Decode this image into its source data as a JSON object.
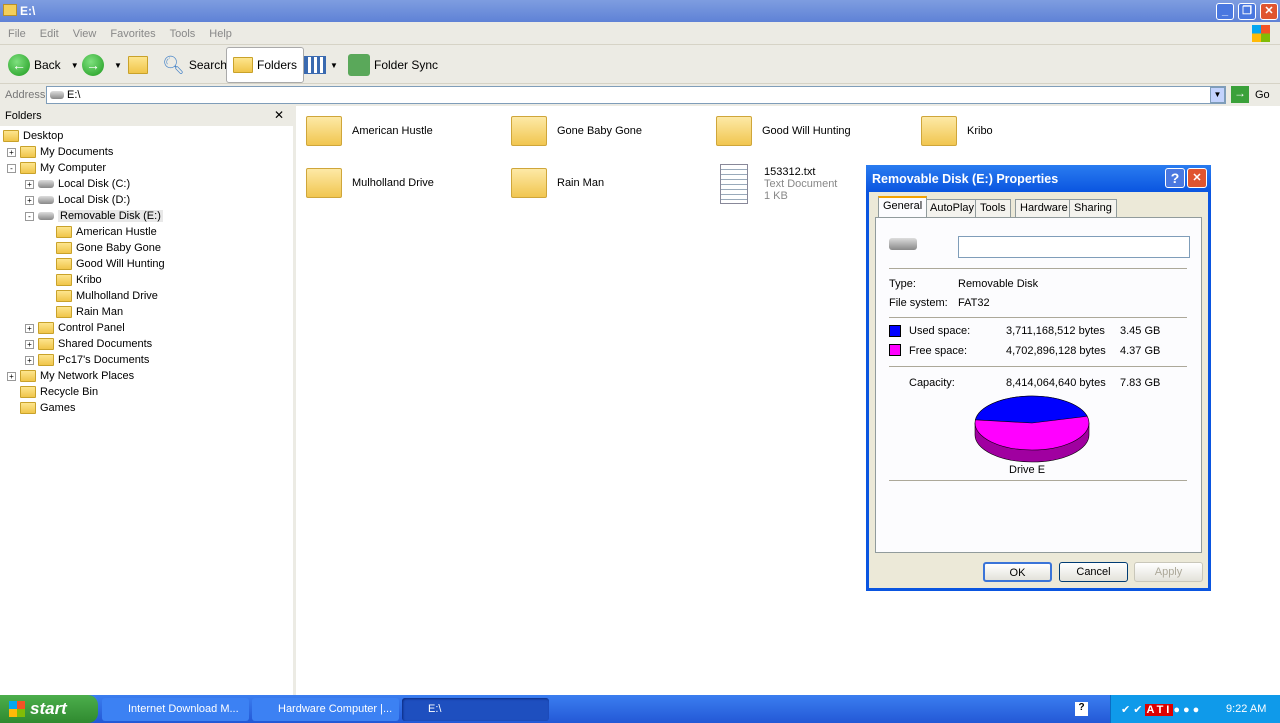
{
  "window": {
    "title": "E:\\"
  },
  "menu": [
    "File",
    "Edit",
    "View",
    "Favorites",
    "Tools",
    "Help"
  ],
  "toolbar": {
    "back": "Back",
    "search": "Search",
    "folders": "Folders",
    "folder_sync": "Folder Sync"
  },
  "address": {
    "label": "Address",
    "value": "E:\\",
    "go": "Go"
  },
  "folders_pane": {
    "title": "Folders",
    "tree": [
      {
        "label": "Desktop",
        "level": 0,
        "exp": ""
      },
      {
        "label": "My Documents",
        "level": 1,
        "exp": "+"
      },
      {
        "label": "My Computer",
        "level": 1,
        "exp": "-"
      },
      {
        "label": "Local Disk (C:)",
        "level": 2,
        "exp": "+"
      },
      {
        "label": "Local Disk (D:)",
        "level": 2,
        "exp": "+"
      },
      {
        "label": "Removable Disk (E:)",
        "level": 2,
        "exp": "-"
      },
      {
        "label": "American Hustle",
        "level": 3,
        "exp": ""
      },
      {
        "label": "Gone Baby Gone",
        "level": 3,
        "exp": ""
      },
      {
        "label": "Good Will Hunting",
        "level": 3,
        "exp": ""
      },
      {
        "label": "Kribo",
        "level": 3,
        "exp": ""
      },
      {
        "label": "Mulholland Drive",
        "level": 3,
        "exp": ""
      },
      {
        "label": "Rain Man",
        "level": 3,
        "exp": ""
      },
      {
        "label": "Control Panel",
        "level": 2,
        "exp": "+"
      },
      {
        "label": "Shared Documents",
        "level": 2,
        "exp": "+"
      },
      {
        "label": "Pc17's Documents",
        "level": 2,
        "exp": "+"
      },
      {
        "label": "My Network Places",
        "level": 1,
        "exp": "+"
      },
      {
        "label": "Recycle Bin",
        "level": 1,
        "exp": ""
      },
      {
        "label": "Games",
        "level": 1,
        "exp": ""
      }
    ]
  },
  "files": [
    {
      "name": "American Hustle"
    },
    {
      "name": "Gone Baby Gone"
    },
    {
      "name": "Good Will Hunting"
    },
    {
      "name": "Kribo"
    },
    {
      "name": "Mulholland Drive"
    },
    {
      "name": "Rain Man"
    },
    {
      "name": "153312.txt",
      "type": "Text Document",
      "size": "1 KB"
    }
  ],
  "dialog": {
    "title": "Removable Disk (E:) Properties",
    "tabs": [
      "General",
      "AutoPlay",
      "Tools",
      "Hardware",
      "Sharing"
    ],
    "label_value": "",
    "type_label": "Type:",
    "type": "Removable Disk",
    "fs_label": "File system:",
    "fs": "FAT32",
    "used_label": "Used space:",
    "used_bytes": "3,711,168,512 bytes",
    "used_gb": "3.45 GB",
    "free_label": "Free space:",
    "free_bytes": "4,702,896,128 bytes",
    "free_gb": "4.37 GB",
    "cap_label": "Capacity:",
    "cap_bytes": "8,414,064,640 bytes",
    "cap_gb": "7.83 GB",
    "drive_label": "Drive E",
    "used_color": "#0000ff",
    "free_color": "#ff00ff",
    "used_fraction": 0.441,
    "ok": "OK",
    "cancel": "Cancel",
    "apply": "Apply"
  },
  "taskbar": {
    "start": "start",
    "tasks": [
      "Internet Download M...",
      "Hardware Computer |...",
      "E:\\"
    ],
    "clock": "9:22 AM"
  }
}
